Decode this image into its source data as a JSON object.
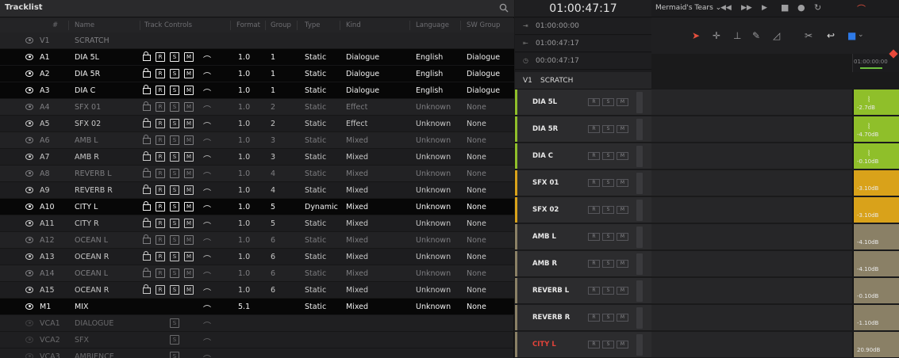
{
  "tracklist": {
    "title": "Tracklist",
    "columns": [
      "#",
      "Name",
      "Track Controls",
      "Format",
      "Group",
      "Type",
      "Kind",
      "Language",
      "SW Group"
    ],
    "rows": [
      {
        "num": "V1",
        "name": "SCRATCH",
        "format": "",
        "group": "",
        "type": "",
        "kind": "",
        "language": "",
        "sw": "",
        "state": "video"
      },
      {
        "num": "A1",
        "name": "DIA 5L",
        "format": "1.0",
        "group": "1",
        "type": "Static",
        "kind": "Dialogue",
        "language": "English",
        "sw": "Dialogue",
        "state": "sel"
      },
      {
        "num": "A2",
        "name": "DIA 5R",
        "format": "1.0",
        "group": "1",
        "type": "Static",
        "kind": "Dialogue",
        "language": "English",
        "sw": "Dialogue",
        "state": "sel"
      },
      {
        "num": "A3",
        "name": "DIA C",
        "format": "1.0",
        "group": "1",
        "type": "Static",
        "kind": "Dialogue",
        "language": "English",
        "sw": "Dialogue",
        "state": "sel"
      },
      {
        "num": "A4",
        "name": "SFX 01",
        "format": "1.0",
        "group": "2",
        "type": "Static",
        "kind": "Effect",
        "language": "Unknown",
        "sw": "None",
        "state": "un"
      },
      {
        "num": "A5",
        "name": "SFX 02",
        "format": "1.0",
        "group": "2",
        "type": "Static",
        "kind": "Effect",
        "language": "Unknown",
        "sw": "None",
        "state": "un"
      },
      {
        "num": "A6",
        "name": "AMB L",
        "format": "1.0",
        "group": "3",
        "type": "Static",
        "kind": "Mixed",
        "language": "Unknown",
        "sw": "None",
        "state": "un"
      },
      {
        "num": "A7",
        "name": "AMB R",
        "format": "1.0",
        "group": "3",
        "type": "Static",
        "kind": "Mixed",
        "language": "Unknown",
        "sw": "None",
        "state": "un"
      },
      {
        "num": "A8",
        "name": "REVERB L",
        "format": "1.0",
        "group": "4",
        "type": "Static",
        "kind": "Mixed",
        "language": "Unknown",
        "sw": "None",
        "state": "un"
      },
      {
        "num": "A9",
        "name": "REVERB R",
        "format": "1.0",
        "group": "4",
        "type": "Static",
        "kind": "Mixed",
        "language": "Unknown",
        "sw": "None",
        "state": "un"
      },
      {
        "num": "A10",
        "name": "CITY L",
        "format": "1.0",
        "group": "5",
        "type": "Dynamic",
        "kind": "Mixed",
        "language": "Unknown",
        "sw": "None",
        "state": "sel"
      },
      {
        "num": "A11",
        "name": "CITY R",
        "format": "1.0",
        "group": "5",
        "type": "Static",
        "kind": "Mixed",
        "language": "Unknown",
        "sw": "None",
        "state": "un"
      },
      {
        "num": "A12",
        "name": "OCEAN L",
        "format": "1.0",
        "group": "6",
        "type": "Static",
        "kind": "Mixed",
        "language": "Unknown",
        "sw": "None",
        "state": "un"
      },
      {
        "num": "A13",
        "name": "OCEAN R",
        "format": "1.0",
        "group": "6",
        "type": "Static",
        "kind": "Mixed",
        "language": "Unknown",
        "sw": "None",
        "state": "un"
      },
      {
        "num": "A14",
        "name": "OCEAN L",
        "format": "1.0",
        "group": "6",
        "type": "Static",
        "kind": "Mixed",
        "language": "Unknown",
        "sw": "None",
        "state": "un"
      },
      {
        "num": "A15",
        "name": "OCEAN R",
        "format": "1.0",
        "group": "6",
        "type": "Static",
        "kind": "Mixed",
        "language": "Unknown",
        "sw": "None",
        "state": "un"
      },
      {
        "num": "M1",
        "name": "MIX",
        "format": "5.1",
        "group": "",
        "type": "Static",
        "kind": "Mixed",
        "language": "Unknown",
        "sw": "None",
        "state": "sel"
      },
      {
        "num": "VCA1",
        "name": "DIALOGUE",
        "format": "",
        "group": "",
        "type": "",
        "kind": "",
        "language": "",
        "sw": "",
        "state": "vca"
      },
      {
        "num": "VCA2",
        "name": "SFX",
        "format": "",
        "group": "",
        "type": "",
        "kind": "",
        "language": "",
        "sw": "",
        "state": "vca"
      },
      {
        "num": "VCA3",
        "name": "AMBIENCE",
        "format": "",
        "group": "",
        "type": "",
        "kind": "",
        "language": "",
        "sw": "",
        "state": "vca"
      }
    ],
    "btn_r": "R",
    "btn_s": "S",
    "btn_m": "M"
  },
  "transport": {
    "timecode": "01:00:47:17",
    "in_tc": "01:00:00:00",
    "out_tc": "01:00:47:17",
    "dur_tc": "00:00:47:17",
    "video_track_num": "V1",
    "video_track_name": "SCRATCH"
  },
  "toolbar": {
    "project": "Mermaid's Tears"
  },
  "timeline": {
    "ruler_tc": "01:00:00:00"
  },
  "tracks": [
    {
      "name": "DIA 5L",
      "color": "#8fbf2a",
      "level": "-2.7dB"
    },
    {
      "name": "DIA 5R",
      "color": "#8fbf2a",
      "level": "-4.70dB"
    },
    {
      "name": "DIA C",
      "color": "#8fbf2a",
      "level": "-0.10dB"
    },
    {
      "name": "SFX 01",
      "color": "#d9a21a",
      "level": "-3.10dB"
    },
    {
      "name": "SFX 02",
      "color": "#d9a21a",
      "level": "-3.10dB"
    },
    {
      "name": "AMB L",
      "color": "#8a8066",
      "level": "-4.10dB"
    },
    {
      "name": "AMB R",
      "color": "#8a8066",
      "level": "-4.10dB"
    },
    {
      "name": "REVERB L",
      "color": "#8a8066",
      "level": "-0.10dB"
    },
    {
      "name": "REVERB R",
      "color": "#8a8066",
      "level": "-1.10dB"
    },
    {
      "name": "CITY L",
      "color": "#8a8066",
      "level": "20.90dB",
      "name_color": "#e2433a"
    }
  ],
  "colors": {
    "playhead": "#e8493a",
    "select_tool": "#e5503e",
    "flag": "#2e7ae8"
  }
}
